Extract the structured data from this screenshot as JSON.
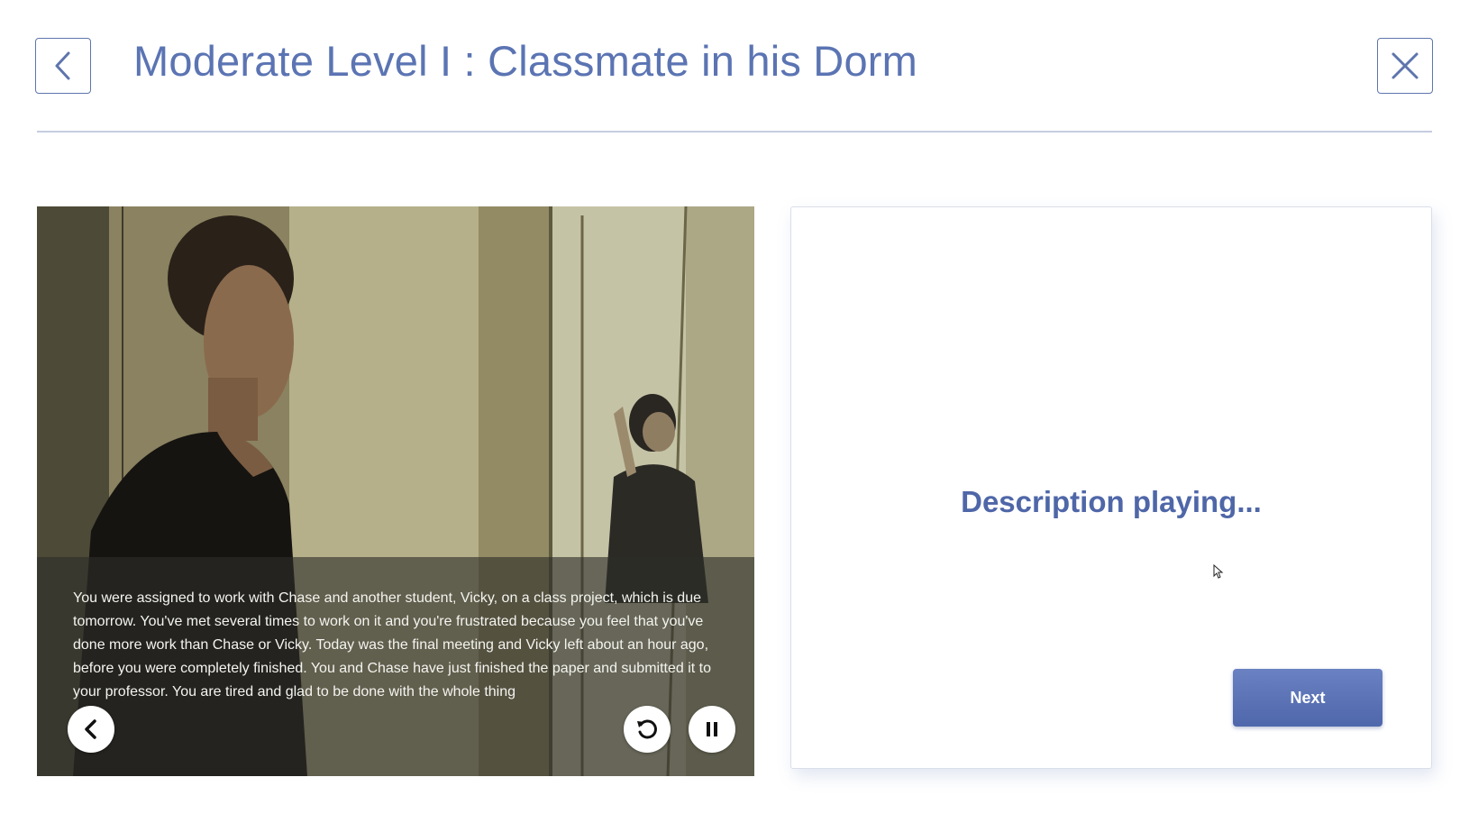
{
  "header": {
    "title": "Moderate Level I : Classmate in his Dorm",
    "back_icon": "chevron-left-icon",
    "close_icon": "close-icon"
  },
  "video": {
    "caption": "You were assigned to work with Chase and another student, Vicky, on a class project, which is due tomorrow. You've met several times to work on it and you're frustrated because you feel that you've done more work than Chase or Vicky. Today was the final meeting and Vicky left about an hour ago, before you were completely finished. You and Chase have just finished the paper and submitted it to your professor. You are tired and glad to be done with the whole thing",
    "controls": {
      "previous_icon": "chevron-left-icon",
      "replay_icon": "replay-icon",
      "pause_icon": "pause-icon"
    }
  },
  "panel": {
    "status": "Description playing...",
    "next_label": "Next"
  },
  "colors": {
    "accent": "#5b74b3",
    "button": "#5a72b5",
    "divider": "#c5cde0"
  }
}
